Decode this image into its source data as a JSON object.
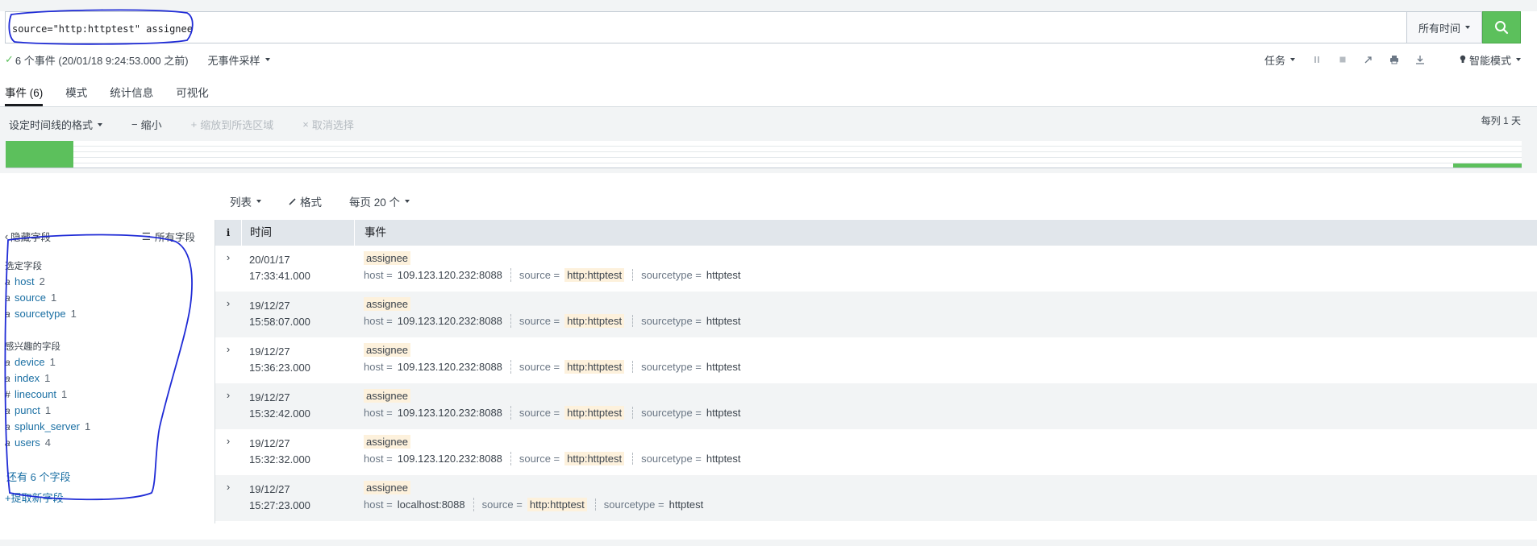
{
  "search": {
    "query": "source=\"http:httptest\" assignee",
    "time_range": "所有时间",
    "search_icon": "search-icon"
  },
  "status": {
    "events_summary": "6 个事件 (20/01/18 9:24:53.000 之前)",
    "sampling": "无事件采样",
    "job_label": "任务",
    "mode_label": "智能模式",
    "icons": [
      "pause-icon",
      "stop-icon",
      "share-icon",
      "print-icon",
      "export-icon",
      "bulb-icon"
    ]
  },
  "tabs": [
    {
      "label": "事件 (6)",
      "active": true
    },
    {
      "label": "模式",
      "active": false
    },
    {
      "label": "统计信息",
      "active": false
    },
    {
      "label": "可视化",
      "active": false
    }
  ],
  "timeline": {
    "format_label": "设定时间线的格式",
    "zoom_out": "缩小",
    "zoom_to_selection": "缩放到所选区域",
    "deselect": "取消选择",
    "per_column": "每列 1 天"
  },
  "results_controls": {
    "list": "列表",
    "format": "格式",
    "per_page": "每页 20 个"
  },
  "sidebar": {
    "hide_fields": "隐藏字段",
    "all_fields": "所有字段",
    "selected_title": "选定字段",
    "selected": [
      {
        "type": "a",
        "name": "host",
        "count": "2"
      },
      {
        "type": "a",
        "name": "source",
        "count": "1"
      },
      {
        "type": "a",
        "name": "sourcetype",
        "count": "1"
      }
    ],
    "interesting_title": "感兴趣的字段",
    "interesting": [
      {
        "type": "a",
        "name": "device",
        "count": "1"
      },
      {
        "type": "a",
        "name": "index",
        "count": "1"
      },
      {
        "type": "#",
        "name": "linecount",
        "count": "1"
      },
      {
        "type": "a",
        "name": "punct",
        "count": "1"
      },
      {
        "type": "a",
        "name": "splunk_server",
        "count": "1"
      },
      {
        "type": "a",
        "name": "users",
        "count": "4"
      }
    ],
    "more_fields": "还有 6 个字段",
    "extract_fields": "提取新字段"
  },
  "table": {
    "col_info": "i",
    "col_time": "时间",
    "col_event": "事件",
    "rows": [
      {
        "date": "20/01/17",
        "clock": "17:33:41.000",
        "raw": "assignee",
        "host": "109.123.120.232:8088",
        "source": "http:httptest",
        "sourcetype": "httptest"
      },
      {
        "date": "19/12/27",
        "clock": "15:58:07.000",
        "raw": "assignee",
        "host": "109.123.120.232:8088",
        "source": "http:httptest",
        "sourcetype": "httptest"
      },
      {
        "date": "19/12/27",
        "clock": "15:36:23.000",
        "raw": "assignee",
        "host": "109.123.120.232:8088",
        "source": "http:httptest",
        "sourcetype": "httptest"
      },
      {
        "date": "19/12/27",
        "clock": "15:32:42.000",
        "raw": "assignee",
        "host": "109.123.120.232:8088",
        "source": "http:httptest",
        "sourcetype": "httptest"
      },
      {
        "date": "19/12/27",
        "clock": "15:32:32.000",
        "raw": "assignee",
        "host": "109.123.120.232:8088",
        "source": "http:httptest",
        "sourcetype": "httptest"
      },
      {
        "date": "19/12/27",
        "clock": "15:27:23.000",
        "raw": "assignee",
        "host": "localhost:8088",
        "source": "http:httptest",
        "sourcetype": "httptest"
      }
    ],
    "key_host": "host =",
    "key_source": "source =",
    "key_sourcetype": "sourcetype ="
  },
  "colors": {
    "accent_green": "#5cc05c",
    "link_blue": "#1a6fa3",
    "highlight": "#fdf1dc",
    "annotation_blue": "#1f2bd6"
  }
}
